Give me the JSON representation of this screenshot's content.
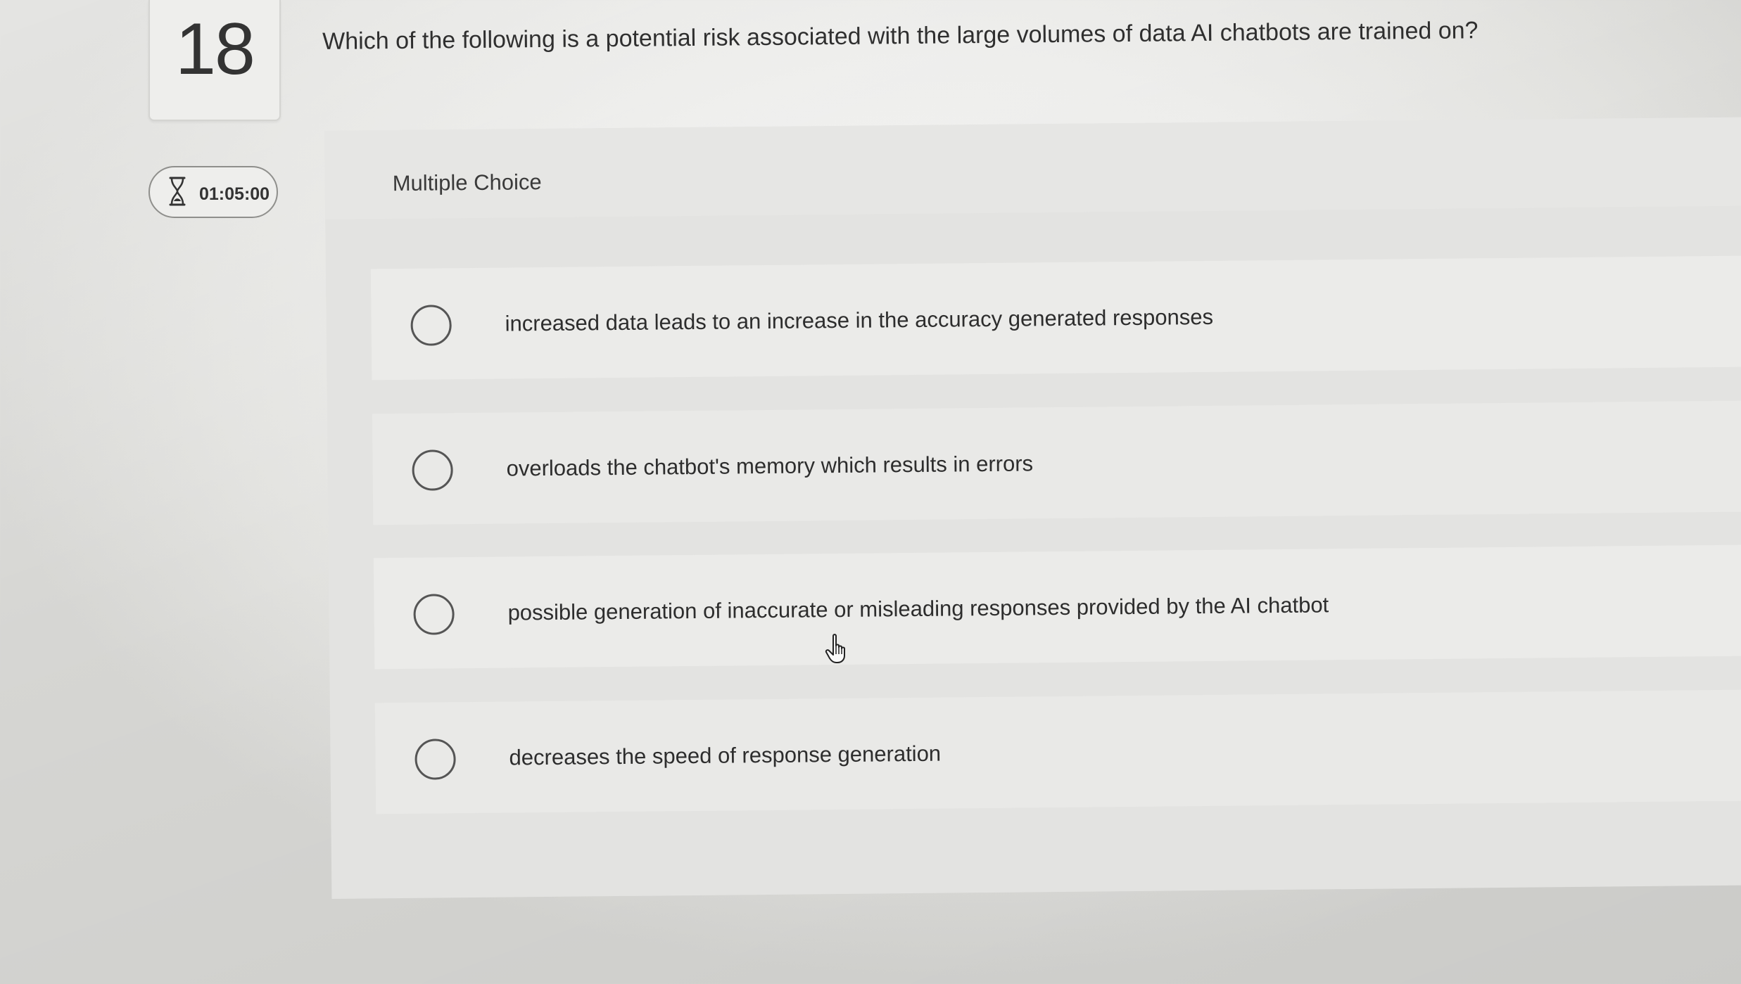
{
  "question": {
    "number": "18",
    "text": "Which of the following is a potential risk associated with the large volumes of data AI chatbots are trained on?"
  },
  "timer": {
    "icon": "hourglass-icon",
    "time": "01:05:00"
  },
  "question_type": "Multiple Choice",
  "options": [
    {
      "label": "increased data leads to an increase in the accuracy generated responses",
      "selected": false
    },
    {
      "label": "overloads the chatbot's memory which results in errors",
      "selected": false
    },
    {
      "label": "possible generation of inaccurate or misleading responses provided by the AI chatbot",
      "selected": false
    },
    {
      "label": "decreases the speed of response generation",
      "selected": false
    }
  ],
  "colors": {
    "background": "#ececea",
    "panel": "#e3e3e1",
    "option_bg": "#ebebe9",
    "radio_border": "#555555",
    "text": "#2d2d2d"
  }
}
